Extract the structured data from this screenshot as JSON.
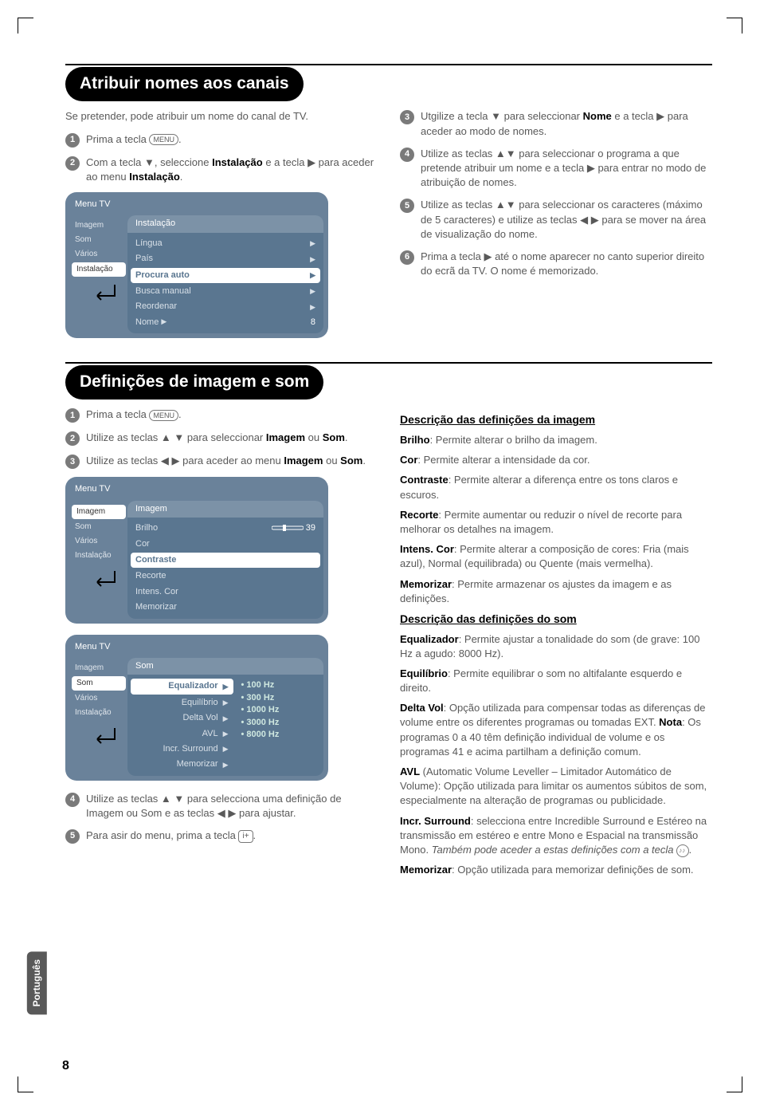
{
  "side_tab": "Português",
  "page_number": "8",
  "section1": {
    "heading": "Atribuir nomes aos canais",
    "intro": "Se pretender, pode atribuir um nome do canal de TV.",
    "left_steps": {
      "s1": {
        "num": "1",
        "body_pre": "Prima a tecla ",
        "body_icon": "MENU",
        "body_post": "."
      },
      "s2": {
        "num": "2",
        "body": "Com a tecla ▼, seleccione <b>Instalação</b> e a tecla ▶ para aceder ao menu <b>Instalação</b>."
      }
    },
    "right_steps": {
      "s3": {
        "num": "3",
        "body": "Utgilize a tecla ▼ para seleccionar <b>Nome</b> e a tecla ▶ para aceder ao modo de nomes."
      },
      "s4": {
        "num": "4",
        "body": "Utilize as teclas ▲▼ para seleccionar o programa a que pretende atribuir um nome e a tecla ▶ para entrar no modo de atribuição de nomes."
      },
      "s5": {
        "num": "5",
        "body": "Utilize as teclas ▲▼ para seleccionar os caracteres (máximo de 5 caracteres) e utilize as teclas ◀ ▶ para se mover na área de visualização do nome."
      },
      "s6": {
        "num": "6",
        "body": "Prima a tecla ▶ até o nome aparecer no canto superior direito do ecrã da TV. O nome é memorizado."
      }
    },
    "menu1": {
      "title": "Menu TV",
      "left": [
        "Imagem",
        "Som",
        "Vários",
        "Instalação"
      ],
      "left_selected": "Instalação",
      "right_title": "Instalação",
      "right_items": [
        {
          "label": "Língua",
          "arrow": "▶",
          "val": ""
        },
        {
          "label": "País",
          "arrow": "▶",
          "val": ""
        },
        {
          "label": "Procura auto",
          "arrow": "▶",
          "val": "",
          "white": true
        },
        {
          "label": "Busca manual",
          "arrow": "▶",
          "val": ""
        },
        {
          "label": "Reordenar",
          "arrow": "▶",
          "val": ""
        },
        {
          "label": "Nome",
          "arrow": "▶",
          "val": "8"
        }
      ]
    }
  },
  "section2": {
    "heading": "Definições de imagem e som",
    "left_steps": {
      "s1": {
        "num": "1",
        "body_pre": "Prima a tecla ",
        "body_icon": "MENU",
        "body_post": "."
      },
      "s2": {
        "num": "2",
        "body": "Utilize as teclas ▲ ▼ para seleccionar <b>Imagem</b> ou <b>Som</b>."
      },
      "s3": {
        "num": "3",
        "body": "Utilize as teclas ◀ ▶ para aceder ao menu <b>Imagem</b> ou <b>Som</b>."
      },
      "s4": {
        "num": "4",
        "body": "Utilize as teclas ▲ ▼ para selecciona uma definição de Imagem ou Som e as teclas ◀ ▶ para ajustar."
      },
      "s5": {
        "num": "5",
        "body_pre": "Para asir do menu, prima a tecla ",
        "body_icon": "i+",
        "body_post": "."
      }
    },
    "menu_image": {
      "title": "Menu TV",
      "left": [
        "Imagem",
        "Som",
        "Vários",
        "Instalação"
      ],
      "left_selected": "Imagem",
      "right_title": "Imagem",
      "right_items": [
        {
          "label": "Brilho",
          "slider": true,
          "val": "39"
        },
        {
          "label": "Cor"
        },
        {
          "label": "Contraste",
          "white": true
        },
        {
          "label": "Recorte"
        },
        {
          "label": "Intens. Cor"
        },
        {
          "label": "Memorizar"
        }
      ]
    },
    "menu_sound": {
      "title": "Menu TV",
      "left": [
        "Imagem",
        "Som",
        "Vários",
        "Instalação"
      ],
      "left_selected": "Som",
      "right_title": "Som",
      "right_items_left": [
        {
          "label": "Equalizador",
          "arrow": "▶"
        },
        {
          "label": "Equilíbrio",
          "arrow": "▶"
        },
        {
          "label": "Delta Vol",
          "arrow": "▶"
        },
        {
          "label": "AVL",
          "arrow": "▶"
        },
        {
          "label": "Incr. Surround",
          "arrow": "▶"
        },
        {
          "label": "Memorizar",
          "arrow": "▶"
        }
      ],
      "right_items_right": [
        "• 100 Hz",
        "• 300 Hz",
        "• 1000 Hz",
        "• 3000 Hz",
        "• 8000 Hz"
      ]
    },
    "descr_image_heading": "Descrição das definições da imagem",
    "descr_image": [
      "<b>Brilho</b>: Permite alterar o brilho da imagem.",
      "<b>Cor</b>: Permite alterar a intensidade da cor.",
      "<b>Contraste</b>: Permite alterar a diferença entre os tons claros e escuros.",
      "<b>Recorte</b>: Permite aumentar ou reduzir o nível de recorte para melhorar os detalhes na imagem.",
      "<b>Intens. Cor</b>: Permite alterar a composição de cores: Fria (mais azul), Normal (equilibrada) ou Quente (mais vermelha).",
      "<b>Memorizar</b>: Permite armazenar os ajustes da imagem e as definições."
    ],
    "descr_sound_heading": "Descrição das definições do som",
    "descr_sound": [
      "<b>Equalizador</b>: Permite ajustar a tonalidade do som (de grave: 100 Hz a agudo: 8000 Hz).",
      "<b>Equilíbrio</b>: Permite equilibrar o som no altifalante esquerdo e direito.",
      "<b>Delta Vol</b>: Opção utilizada para compensar todas as diferenças de volume entre os diferentes programas ou tomadas EXT. <b>Nota</b>: Os programas 0 a 40 têm definição individual de volume e os programas 41 e acima partilham a definição comum.",
      "<b>AVL</b> (Automatic Volume Leveller – Limitador Automático de Volume): Opção utilizada para limitar os aumentos súbitos de som, especialmente na alteração de programas ou publicidade.",
      "<b>Incr. Surround</b>: selecciona entre Incredible Surround e Estéreo na transmissão em estéreo e entre Mono e Espacial na transmissão Mono. <span class=\"italic\">Também pode aceder a estas definições com a tecla <span class=\"sound-icon\"></span>.</span>",
      "<b>Memorizar</b>: Opção utilizada para memorizar definições de som."
    ]
  }
}
